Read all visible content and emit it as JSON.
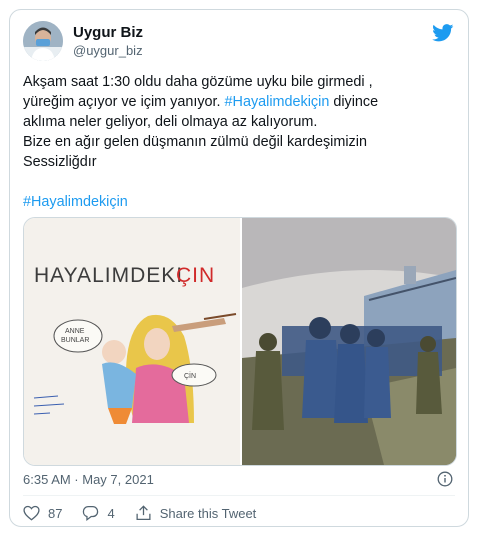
{
  "author": {
    "name": "Uygur Biz",
    "handle": "@uygur_biz"
  },
  "tweet": {
    "line1": "Akşam saat 1:30 oldu daha gözüme uyku bile girmedi ,",
    "line2_pre": "yüreğim açıyor ve içim yanıyor. ",
    "hashtag_inline": "#Hayalimdekiçin",
    "line2_post": " diyince",
    "line3": "aklıma neler geliyor, deli olmaya az kalıyorum.",
    "line4": "Bize en ağır gelen düşmanın zülmü değil kardeşimizin",
    "line5": "Sessizliğdır",
    "hashtag_bottom": "#Hayalimdekiçin"
  },
  "media": {
    "drawing_title_black": "HAYALIMDEKI",
    "drawing_title_red": "ÇIN",
    "bubble_left_1": "ANNE",
    "bubble_left_2": "BUNLAR",
    "bubble_right": "ÇİN"
  },
  "meta": {
    "timestamp": "6:35 AM · May 7, 2021"
  },
  "actions": {
    "likes": "87",
    "replies": "4",
    "share_label": "Share this Tweet"
  },
  "colors": {
    "link": "#1d9bf0",
    "twitter_blue": "#1d9bf0",
    "muted": "#536471"
  }
}
